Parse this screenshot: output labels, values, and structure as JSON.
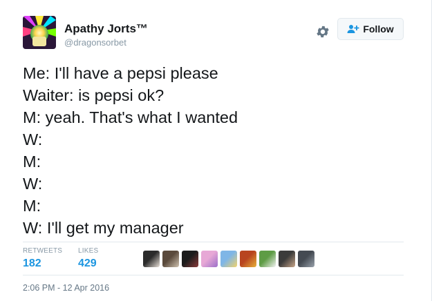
{
  "author": {
    "name": "Apathy Jorts™",
    "handle": "@dragonsorbet"
  },
  "follow_button": {
    "label": "Follow"
  },
  "tweet": {
    "lines": [
      "Me: I'll have a pepsi please",
      "Waiter: is pepsi ok?",
      "M: yeah. That's what I wanted",
      "W:",
      "M:",
      "W:",
      "M:",
      "W: I'll get my manager"
    ]
  },
  "stats": {
    "retweets_label": "RETWEETS",
    "retweets": "182",
    "likes_label": "LIKES",
    "likes": "429"
  },
  "likers": [
    {
      "icon": "liker-avatar-1",
      "colors": [
        "#2b2b2b",
        "#e8e0d8"
      ]
    },
    {
      "icon": "liker-avatar-2",
      "colors": [
        "#5a4a3c",
        "#cfc2b0"
      ]
    },
    {
      "icon": "liker-avatar-3",
      "colors": [
        "#1c1c1c",
        "#8a3a3a"
      ]
    },
    {
      "icon": "liker-avatar-4",
      "colors": [
        "#e7a8d6",
        "#9b6fc9"
      ]
    },
    {
      "icon": "liker-avatar-5",
      "colors": [
        "#7fb6e6",
        "#f2d36b"
      ]
    },
    {
      "icon": "liker-avatar-6",
      "colors": [
        "#b8441f",
        "#e8b23a"
      ]
    },
    {
      "icon": "liker-avatar-7",
      "colors": [
        "#5e9c45",
        "#f3f3f3"
      ]
    },
    {
      "icon": "liker-avatar-8",
      "colors": [
        "#3b3b3b",
        "#c9a68a"
      ]
    },
    {
      "icon": "liker-avatar-9",
      "colors": [
        "#444a52",
        "#9aa3ad"
      ]
    }
  ],
  "timestamp": "2:06 PM - 12 Apr 2016",
  "colors": {
    "link_blue": "#1b95e0",
    "muted": "#8899a6",
    "border": "#e1e8ed"
  }
}
